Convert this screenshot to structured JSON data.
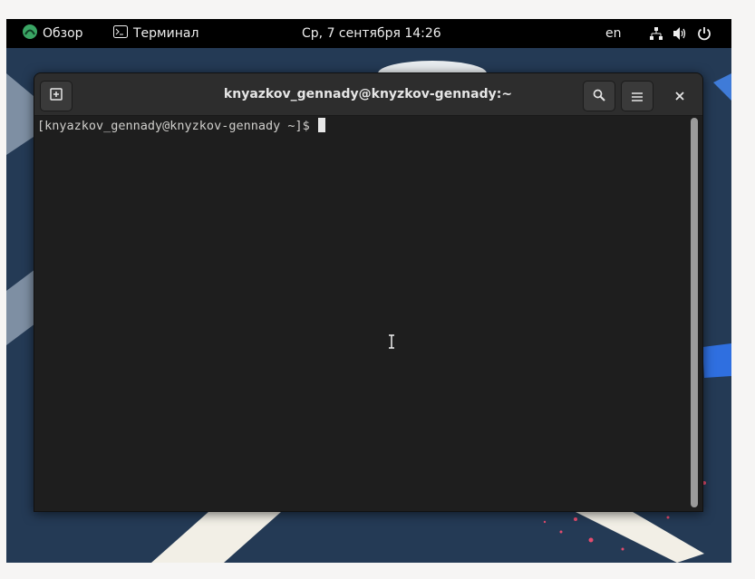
{
  "topbar": {
    "activities_label": "Обзор",
    "app_label": "Терминал",
    "clock": "Ср, 7 сентября  14:26",
    "language": "en"
  },
  "window": {
    "title": "knyazkov_gennady@knyzkov-gennady:~"
  },
  "terminal": {
    "prompt": "[knyazkov_gennady@knyzkov-gennady ~]$ "
  },
  "icons": [
    "activities-logo-icon",
    "terminal-app-icon",
    "network-icon",
    "volume-icon",
    "power-icon",
    "new-tab-icon",
    "search-icon",
    "hamburger-menu-icon",
    "close-icon",
    "text-cursor-icon"
  ],
  "colors": {
    "topbar_bg": "#000000",
    "wallpaper_bg": "#243a55",
    "terminal_bg": "#1e1e1e",
    "headerbar_bg": "#2d2d2d",
    "accent_green": "#3aa564"
  }
}
